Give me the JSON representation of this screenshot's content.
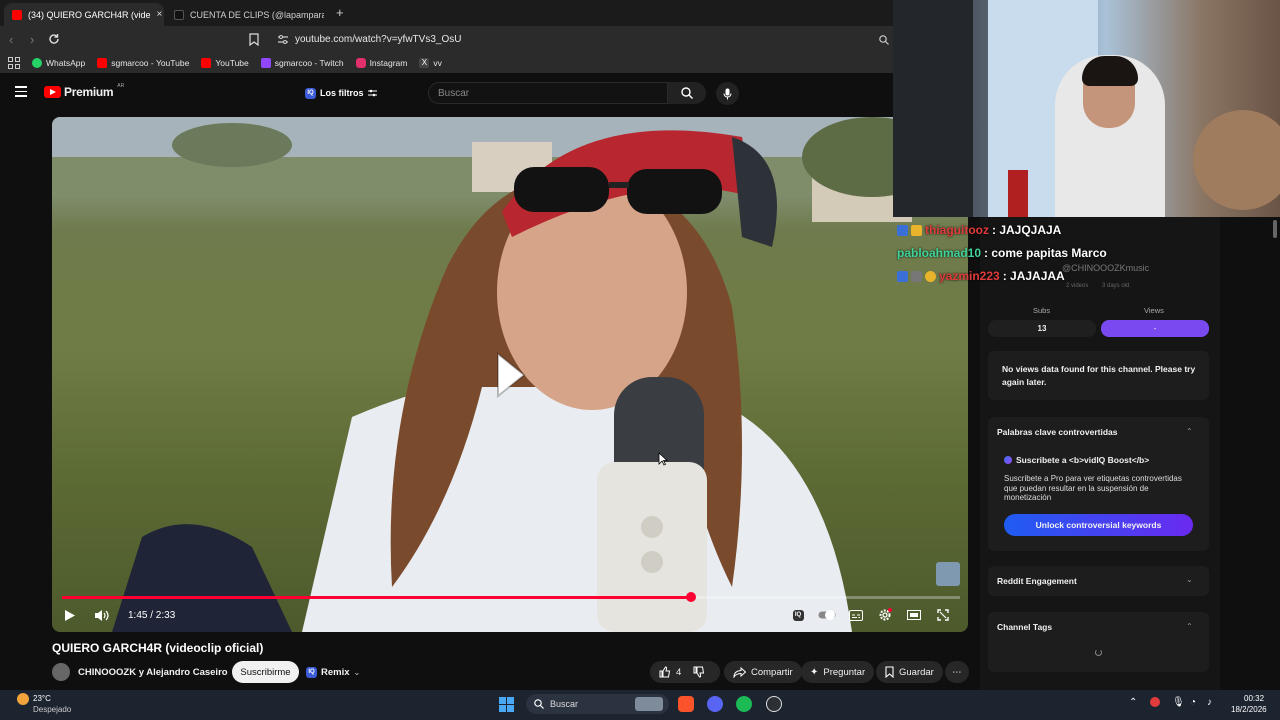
{
  "browser": {
    "tabs": [
      {
        "label": "(34) QUIERO GARCH4R (vide",
        "close": "×",
        "active": true,
        "color": "#ff0000"
      },
      {
        "label": "CUENTA DE CLIPS (@lapampara.clips",
        "close": "",
        "active": false,
        "color": "#111111"
      }
    ],
    "new_tab": "+",
    "url": "youtube.com/watch?v=yfwTVs3_OsU",
    "bookmarks": [
      {
        "label": "WhatsApp",
        "color": "#25d366"
      },
      {
        "label": "sgmarcoo - YouTube",
        "color": "#ff0000"
      },
      {
        "label": "YouTube",
        "color": "#ff0000"
      },
      {
        "label": "sgmarcoo - Twitch",
        "color": "#9146ff"
      },
      {
        "label": "Instagram",
        "color": "#e1306c"
      },
      {
        "label": "vv",
        "color": "#444444"
      }
    ]
  },
  "youtube": {
    "logo_text": "Premium",
    "region": "AR",
    "filters_label": "Los filtros",
    "search_placeholder": "Buscar",
    "video": {
      "time": "1:45 / 2:33",
      "progress": 0.7,
      "title": "QUIERO GARCH4R (videoclip oficial)",
      "channel": "CHINOOOZK y Alejandro Caseiro",
      "subscribe": "Suscribirme",
      "remix": "Remix",
      "likes": "4",
      "share": "Compartir",
      "ask": "Preguntar",
      "save": "Guardar",
      "more": "⋯"
    }
  },
  "chat": [
    {
      "user": "thiaguitooz",
      "message": ": JAJQJAJA",
      "color": "#e23b3b"
    },
    {
      "user": "pabloahmad10",
      "message": ": come papitas Marco",
      "color": "#3fd39a"
    },
    {
      "user": "yazmin223",
      "message": ": JAJAJAA",
      "color": "#e23b3b"
    }
  ],
  "panel": {
    "handle": "@CHINOOOZKmusic",
    "videos_meta": "2 videos",
    "age_meta": "3 days old",
    "subs_label": "Subs",
    "subs_value": "13",
    "views_label": "Views",
    "views_value": "-",
    "no_views": "No views data found for this channel. Please try again later.",
    "controversial": {
      "title": "Palabras clave controvertidas",
      "boost": "Suscribete a <b>vidIQ Boost</b>",
      "desc": "Suscribete a Pro para ver etiquetas controvertidas que puedan resultar en la suspensión de monetización",
      "button": "Unlock controversial keywords"
    },
    "reddit_title": "Reddit Engagement",
    "tags_title": "Channel Tags"
  },
  "taskbar": {
    "temp": "23°C",
    "condition": "Despejado",
    "search": "Buscar",
    "time": "00:32",
    "date": "18/2/2026"
  }
}
